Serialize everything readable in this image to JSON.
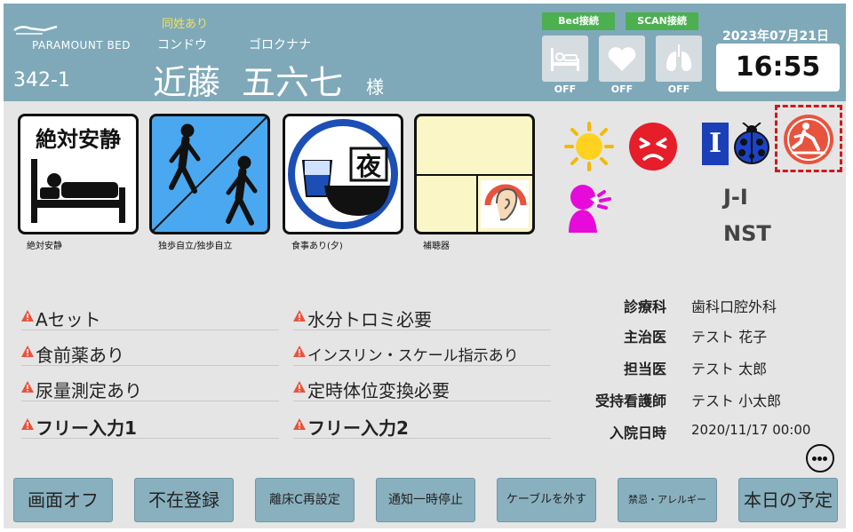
{
  "header": {
    "logo_text": "PARAMOUNT BED",
    "room": "342-1",
    "same_name_note": "同姓あり",
    "kana_last": "コンドウ",
    "kana_first": "ゴロクナナ",
    "name_last": "近藤",
    "name_first": "五六七",
    "honorific": "様",
    "bed_connection": "Bed接続",
    "scan_connection": "SCAN接続",
    "sensors": [
      {
        "icon": "bed-sensor-icon",
        "status": "OFF"
      },
      {
        "icon": "heart-sensor-icon",
        "status": "OFF"
      },
      {
        "icon": "lungs-sensor-icon",
        "status": "OFF"
      }
    ],
    "date": "2023年07月21日(金)",
    "time": "16:55"
  },
  "cards": [
    {
      "title": "絶対安静",
      "label": "絶対安静"
    },
    {
      "label": "独歩自立/独歩自立"
    },
    {
      "badge": "夜",
      "label": "食事あり(夕)"
    },
    {
      "label": "補聴器"
    }
  ],
  "status_icons": [
    "sun-icon",
    "angry-face-icon",
    "insulin-i-icon",
    "ladybug-icon",
    "fall-risk-icon",
    "shouting-person-icon"
  ],
  "insulin_letter": "I",
  "codes": [
    "J-I",
    "NST"
  ],
  "notes": [
    "Aセット",
    "食前薬あり",
    "尿量測定あり",
    "フリー入力1",
    "水分トロミ必要",
    "インスリン・スケール指示あり",
    "定時体位変換必要",
    "フリー入力2"
  ],
  "info": [
    {
      "label": "診療科",
      "value": "歯科口腔外科"
    },
    {
      "label": "主治医",
      "value": "テスト 花子"
    },
    {
      "label": "担当医",
      "value": "テスト 太郎"
    },
    {
      "label": "受持看護師",
      "value": "テスト 小太郎"
    },
    {
      "label": "入院日時",
      "value": "2020/11/17 00:00"
    }
  ],
  "buttons": [
    "画面オフ",
    "不在登録",
    "離床C再設定",
    "通知一時停止",
    "ケーブルを外す",
    "禁忌・アレルギー",
    "本日の予定"
  ],
  "colors": {
    "header": "#7fa9b9",
    "background": "#e5e5e5",
    "connected": "#4caf50",
    "button": "#89b0bf",
    "warning": "#e8533e",
    "walk_card": "#4aa8f0",
    "hearing_card": "#faf6c6",
    "fall_icon": "#e8533e",
    "highlight": "#d01818"
  }
}
